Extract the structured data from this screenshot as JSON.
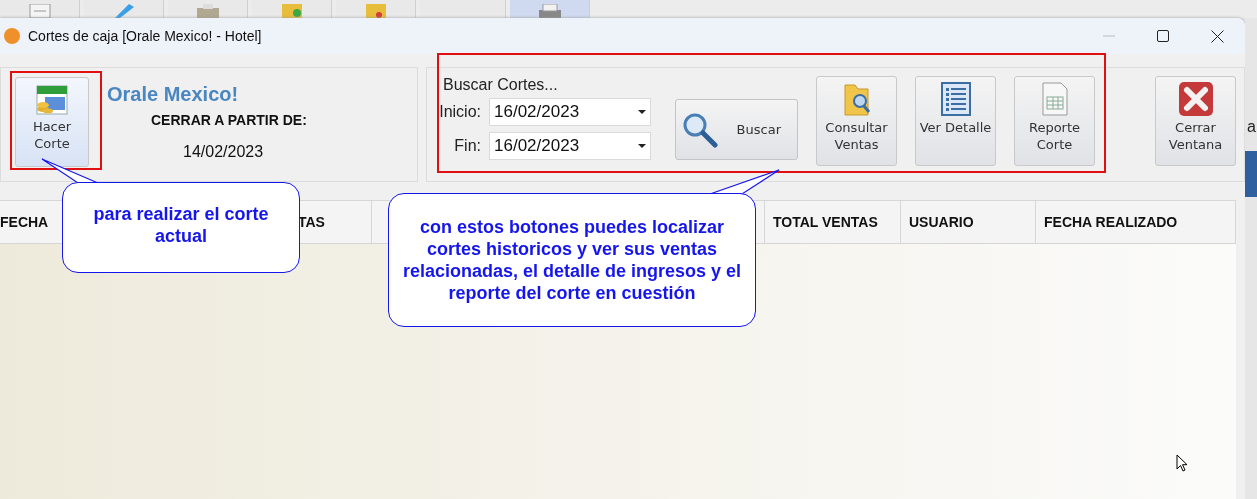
{
  "background_toolbar": {
    "buttons": [
      {
        "kind": "document",
        "selected": false
      },
      {
        "kind": "pencil",
        "selected": false
      },
      {
        "kind": "register",
        "selected": false
      },
      {
        "kind": "folder-in",
        "selected": false
      },
      {
        "kind": "folder-out",
        "selected": false
      },
      {
        "kind": "blank",
        "selected": false
      },
      {
        "kind": "printer",
        "selected": true
      }
    ]
  },
  "window": {
    "title": "Cortes de caja [Orale Mexico! - Hotel]"
  },
  "cut_panel": {
    "button": {
      "label": "Hacer Corte",
      "kind": "calendar"
    },
    "business_name": "Orale Mexico!",
    "close_from_label": "CERRAR A PARTIR DE:",
    "close_from_date": "14/02/2023"
  },
  "search_panel": {
    "title": "Buscar Cortes...",
    "start_label": "Inicio:",
    "start_date": "16/02/2023",
    "end_label": "Fin:",
    "end_date": "16/02/2023",
    "search_button": "Buscar",
    "buttons": [
      {
        "label": "Consultar Ventas",
        "kind": "folder"
      },
      {
        "label": "Ver Detalle",
        "kind": "list"
      },
      {
        "label": "Reporte Corte",
        "kind": "sheet"
      }
    ]
  },
  "close_button": {
    "label": "Cerrar Ventana",
    "kind": "close"
  },
  "table": {
    "columns": [
      "FECHA",
      "TAS",
      "TOTAL VENTAS",
      "USUARIO",
      "FECHA REALIZADO"
    ]
  },
  "callouts": [
    {
      "text": "para realizar el corte actual"
    },
    {
      "text": "con estos botones puedes localizar cortes historicos y ver sus ventas relacionadas, el detalle de ingresos y el reporte del corte en cuestión"
    }
  ],
  "background_window": {
    "text_fragment": "a"
  }
}
